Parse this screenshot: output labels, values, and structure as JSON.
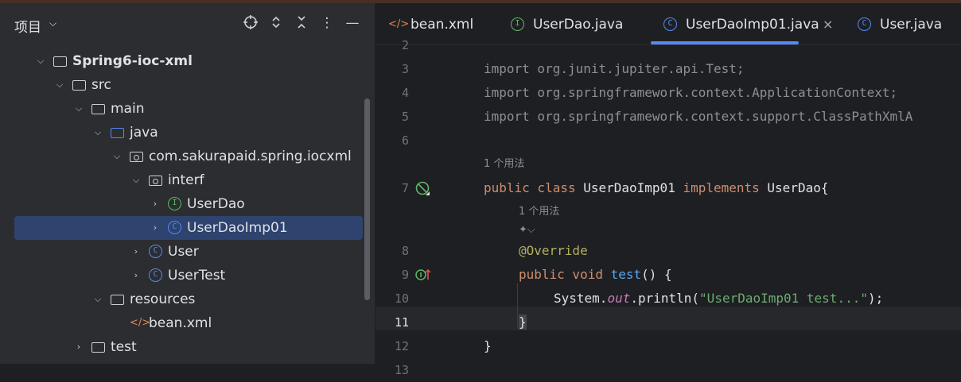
{
  "project_panel": {
    "title": "项目",
    "tree": [
      {
        "label": "Spring6-ioc-xml",
        "bold": true,
        "expanded": true,
        "icon": "module-folder-icon"
      },
      {
        "label": "src",
        "expanded": true,
        "icon": "folder-icon"
      },
      {
        "label": "main",
        "expanded": true,
        "icon": "folder-icon"
      },
      {
        "label": "java",
        "expanded": true,
        "icon": "source-folder-icon"
      },
      {
        "label": "com.sakurapaid.spring.iocxml",
        "expanded": true,
        "icon": "package-icon"
      },
      {
        "label": "interf",
        "expanded": true,
        "icon": "package-icon"
      },
      {
        "label": "UserDao",
        "expanded": false,
        "icon": "interface-icon",
        "icon_letter": "I"
      },
      {
        "label": "UserDaoImp01",
        "expanded": false,
        "icon": "class-icon",
        "icon_letter": "C",
        "selected": true
      },
      {
        "label": "User",
        "expanded": false,
        "icon": "class-icon",
        "icon_letter": "C"
      },
      {
        "label": "UserTest",
        "expanded": false,
        "icon": "class-icon",
        "icon_letter": "C"
      },
      {
        "label": "resources",
        "expanded": true,
        "icon": "resources-folder-icon"
      },
      {
        "label": "bean.xml",
        "icon": "xml-file-icon"
      },
      {
        "label": "test",
        "expanded": false,
        "icon": "folder-icon"
      }
    ]
  },
  "tabs": [
    {
      "label": "bean.xml",
      "icon": "xml-file-icon"
    },
    {
      "label": "UserDao.java",
      "icon": "interface-icon",
      "icon_letter": "I"
    },
    {
      "label": "UserDaoImp01.java",
      "icon": "class-icon",
      "icon_letter": "C",
      "active": true,
      "close": "×"
    },
    {
      "label": "User.java",
      "icon": "class-icon",
      "icon_letter": "C"
    }
  ],
  "editor": {
    "line_numbers": [
      "2",
      "3",
      "4",
      "5",
      "6",
      "7",
      "8",
      "9",
      "10",
      "11",
      "12",
      "13"
    ],
    "current_line": "11",
    "usage_hint_1": "1 个用法",
    "usage_hint_2": "1 个用法",
    "lines": {
      "l3_kw": "import",
      "l3_rest": " org.junit.jupiter.api.Test;",
      "l4_kw": "import",
      "l4_rest": " org.springframework.context.ApplicationContext;",
      "l5_kw": "import",
      "l5_rest": " org.springframework.context.support.ClassPathXmlA",
      "l7_kw1": "public class",
      "l7_name": " UserDaoImp01 ",
      "l7_kw2": "implements",
      "l7_rest": " UserDao{",
      "l8_ann": "@Override",
      "l9_kw": "public void",
      "l9_fn": " test",
      "l9_rest": "() {",
      "l10_pre": "System.",
      "l10_fld": "out",
      "l10_mid": ".println(",
      "l10_str": "\"UserDaoImp01 test...\"",
      "l10_end": ");",
      "l11": "}",
      "l12": "}"
    }
  }
}
